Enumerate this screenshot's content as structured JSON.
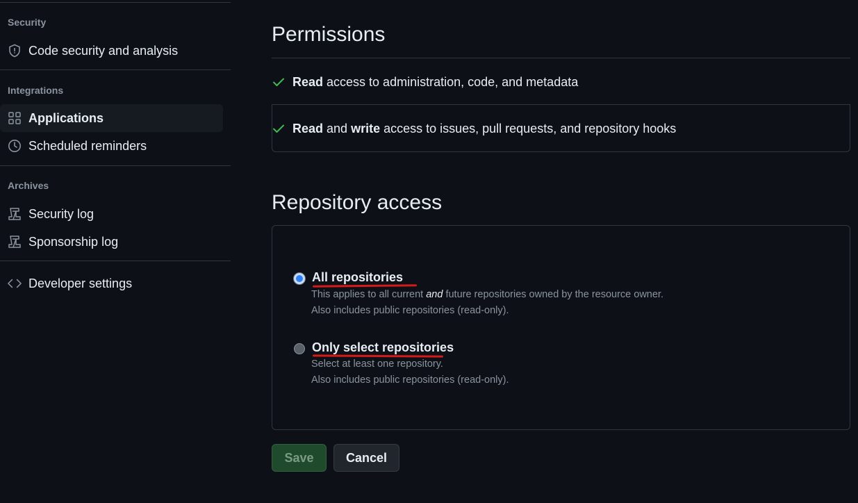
{
  "sidebar": {
    "sections": [
      {
        "heading": "Security",
        "items": [
          {
            "label": "Code security and analysis",
            "icon": "shield-icon"
          }
        ]
      },
      {
        "heading": "Integrations",
        "items": [
          {
            "label": "Applications",
            "icon": "apps-grid-icon",
            "active": true
          },
          {
            "label": "Scheduled reminders",
            "icon": "clock-icon"
          }
        ]
      },
      {
        "heading": "Archives",
        "items": [
          {
            "label": "Security log",
            "icon": "log-icon"
          },
          {
            "label": "Sponsorship log",
            "icon": "log-icon"
          }
        ]
      }
    ],
    "developer_settings": {
      "label": "Developer settings",
      "icon": "code-icon"
    }
  },
  "permissions": {
    "title": "Permissions",
    "rows": [
      {
        "parts": [
          "Read",
          " access to administration, code, and metadata"
        ]
      },
      {
        "parts": [
          "Read",
          " and ",
          "write",
          " access to issues, pull requests, and repository hooks"
        ]
      }
    ]
  },
  "repository_access": {
    "title": "Repository access",
    "options": [
      {
        "label": "All repositories",
        "checked": true,
        "desc_line1_pre": "This applies to all current ",
        "desc_line1_em": "and",
        "desc_line1_post": " future repositories owned by the resource owner.",
        "desc_line2": "Also includes public repositories (read-only)."
      },
      {
        "label": "Only select repositories",
        "checked": false,
        "desc_line1": "Select at least one repository.",
        "desc_line2": "Also includes public repositories (read-only)."
      }
    ]
  },
  "buttons": {
    "save": "Save",
    "cancel": "Cancel"
  },
  "colors": {
    "background": "#0d1117",
    "check": "#3fb950",
    "annotation_underline": "#d51a1a",
    "save_button": "#1f4b2c"
  }
}
